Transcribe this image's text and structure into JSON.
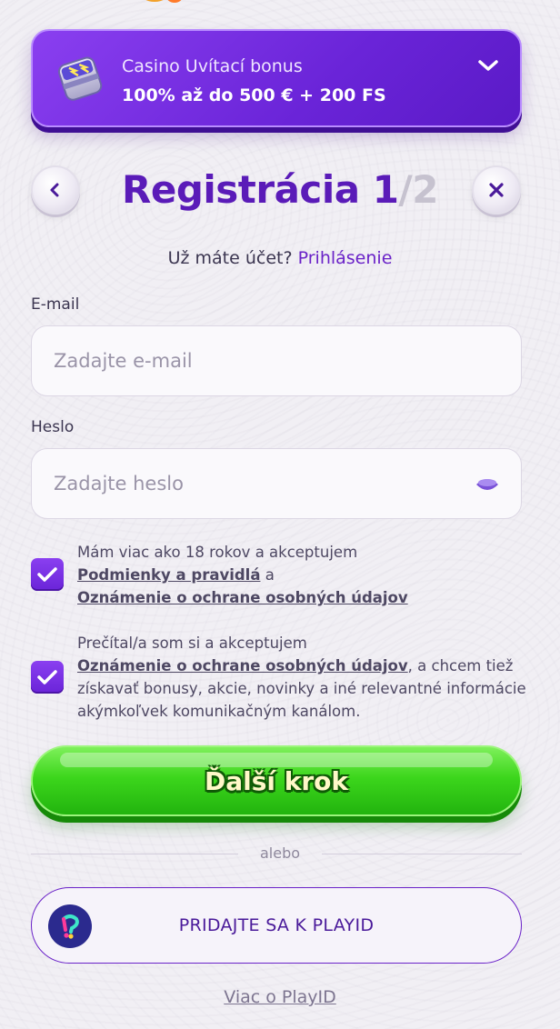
{
  "bonus": {
    "title": "Casino Uvítací bonus",
    "amount": "100% až do 500 € + 200 FS"
  },
  "header": {
    "title": "Registrácia",
    "step_current": "1",
    "step_total": "/2"
  },
  "login": {
    "question": "Už máte účet?",
    "link": "Prihlásenie"
  },
  "email": {
    "label": "E-mail",
    "placeholder": "Zadajte e-mail",
    "value": ""
  },
  "password": {
    "label": "Heslo",
    "placeholder": "Zadajte heslo",
    "value": ""
  },
  "consent_terms": {
    "checked": true,
    "text_1": "Mám viac ako 18 rokov a akceptujem",
    "link_terms": "Podmienky a pravidlá",
    "text_2": "a",
    "link_privacy": "Oznámenie o ochrane osobných údajov"
  },
  "consent_marketing": {
    "checked": true,
    "text_1": "Prečítal/a som si a akceptujem",
    "link_privacy": "Oznámenie o ochrane osobných údajov",
    "text_2": ", a chcem tiež získavať bonusy, akcie, novinky a iné relevantné informácie akýmkoľvek komunikačným kanálom."
  },
  "next_button": {
    "label": "Ďalší krok"
  },
  "divider": {
    "label": "alebo"
  },
  "playid": {
    "button_label": "PRIDAJTE SA K PLAYID",
    "more_link": "Viac o PlayID"
  },
  "colors": {
    "brand_purple": "#6a24d8",
    "cta_green": "#3cd61c",
    "background": "#f1eff4"
  },
  "icons": [
    "bonus-gift-icon",
    "chevron-down-icon",
    "chevron-left-icon",
    "close-icon",
    "eye-icon",
    "checkmark-icon",
    "playid-logo-icon"
  ]
}
